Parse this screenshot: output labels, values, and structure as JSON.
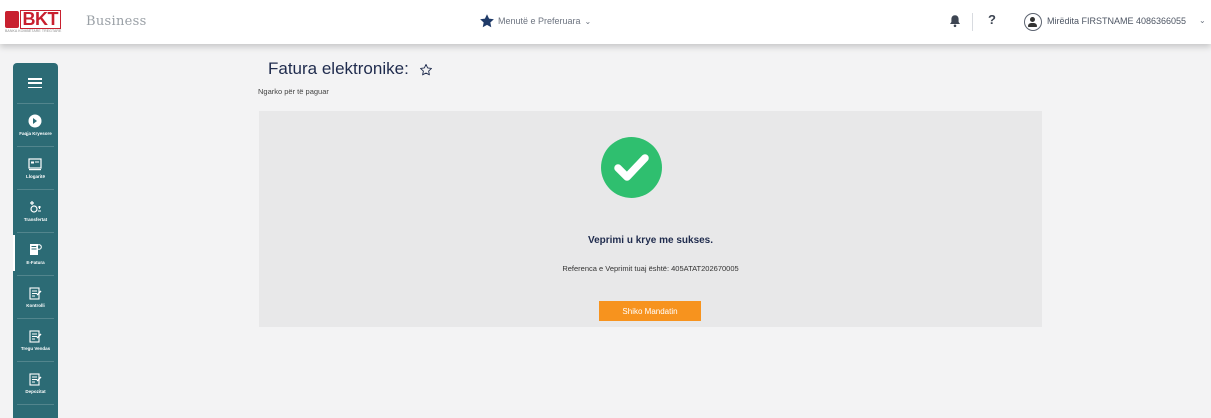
{
  "header": {
    "logo_text": "BKT",
    "logo_subtext": "BANKA KOMBËTARE TREGTARE",
    "brand": "Business",
    "favorites_label": "Menutë e Preferuara",
    "help_label": "?",
    "user_name": "Mirëdita FIRSTNAME 4086366055"
  },
  "sidebar": {
    "items": [
      {
        "label": "Faqja Kryesore",
        "icon": "home-icon"
      },
      {
        "label": "Llogaritë",
        "icon": "accounts-icon"
      },
      {
        "label": "Transfertat",
        "icon": "transfers-icon"
      },
      {
        "label": "E-Fatura",
        "icon": "e-invoice-icon"
      },
      {
        "label": "Kontrolli",
        "icon": "control-icon"
      },
      {
        "label": "Tregu Vendas",
        "icon": "local-market-icon"
      },
      {
        "label": "Depozitat",
        "icon": "deposits-icon"
      }
    ]
  },
  "main": {
    "title": "Fatura elektronike:",
    "subtitle": "Ngarko për të paguar",
    "success_title": "Veprimi u krye me sukses.",
    "reference_text": "Referenca e Veprimit tuaj është: 405ATAT202670005",
    "button_label": "Shiko Mandatin"
  },
  "colors": {
    "sidebar_bg": "#2c6b75",
    "success_green": "#2fbf6f",
    "button_orange": "#f7931e",
    "brand_red": "#c8202f",
    "star_navy": "#1f3a68"
  }
}
